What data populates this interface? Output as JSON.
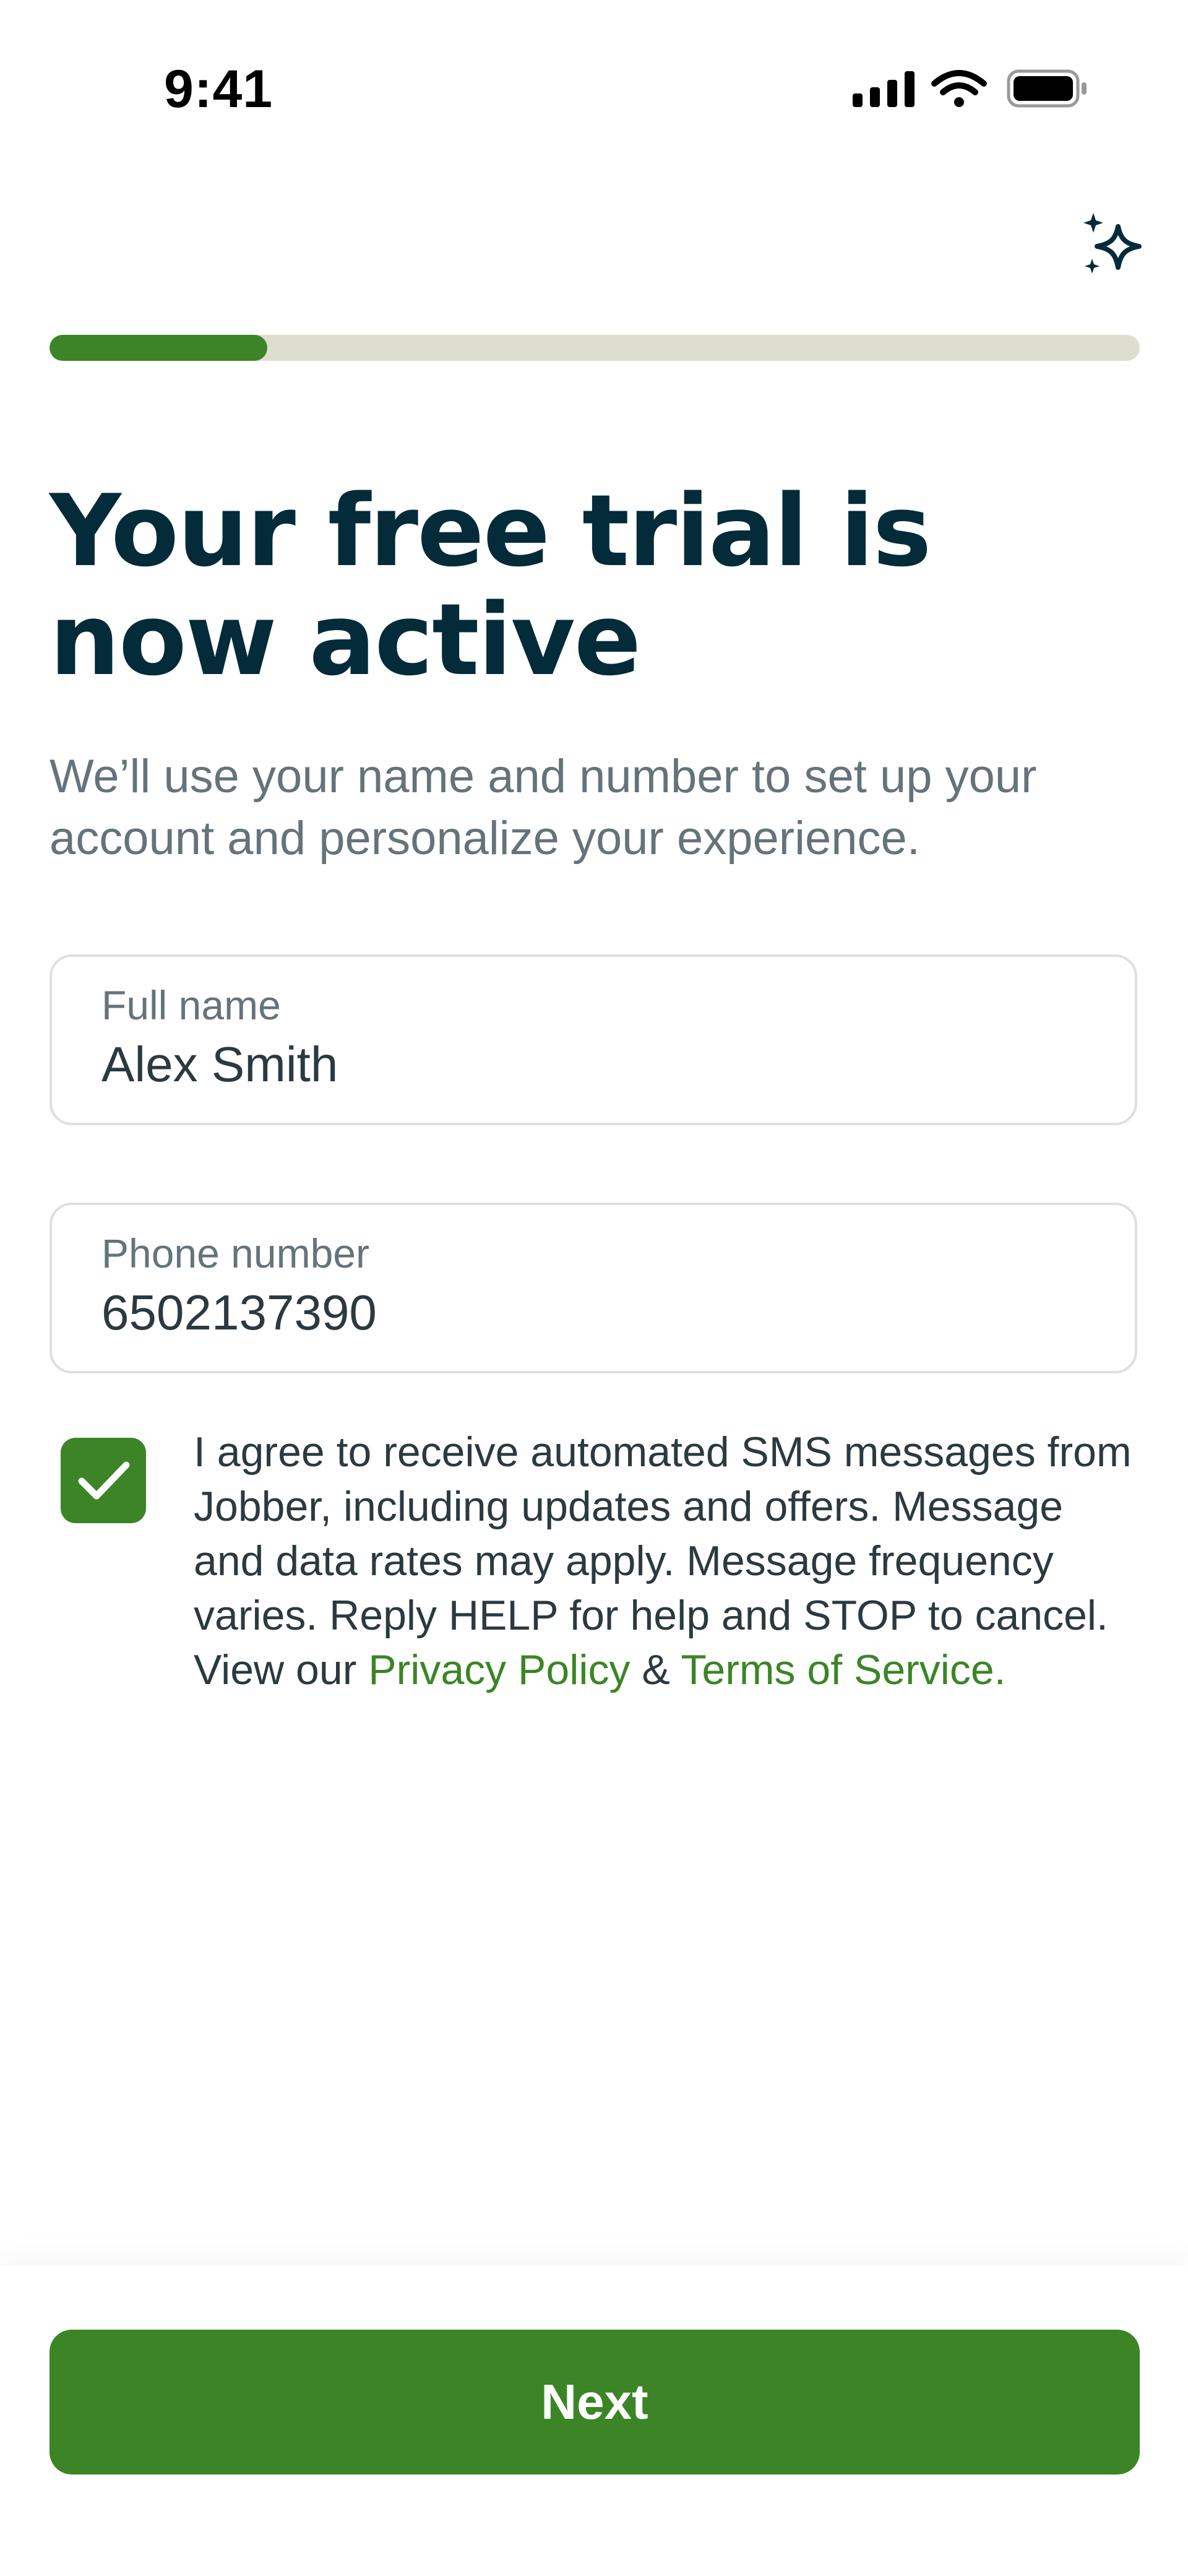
{
  "status_bar": {
    "time": "9:41",
    "icons": [
      "cellular-signal-icon",
      "wifi-icon",
      "battery-icon"
    ]
  },
  "header": {
    "action_icon": "sparkle-icon"
  },
  "progress": {
    "value": 0.2,
    "fill_color": "#3b8526",
    "track_color": "#dedecf"
  },
  "title": "Your free trial is now active",
  "subtitle": "We’ll use your name and number to set up your account and personalize your experience.",
  "form": {
    "full_name": {
      "label": "Full name",
      "value": "Alex Smith"
    },
    "phone": {
      "label": "Phone number",
      "value": "6502137390"
    },
    "consent": {
      "checked": true,
      "text": "I agree to receive automated SMS messages from Jobber, including updates and offers. Message and data rates may apply. Message frequency varies. Reply HELP for help and STOP to cancel. View our ",
      "privacy_link": "Privacy Policy",
      "joiner": " & ",
      "terms_link": "Terms of Service."
    }
  },
  "footer": {
    "next_label": "Next"
  },
  "colors": {
    "primary": "#3b8526",
    "heading": "#032b3a",
    "muted": "#65737a"
  }
}
